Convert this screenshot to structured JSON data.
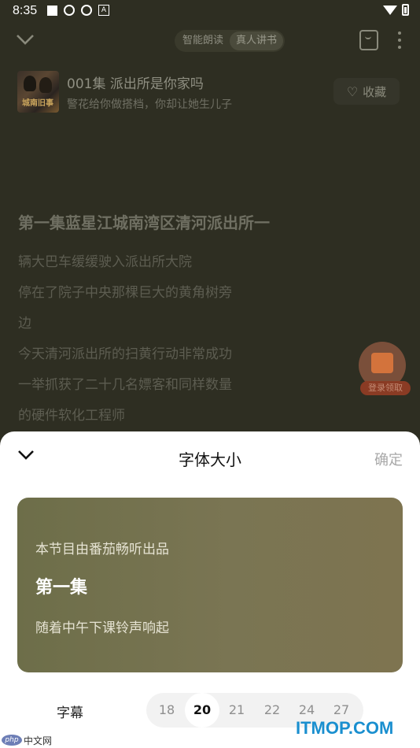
{
  "status_bar": {
    "time": "8:35",
    "icons": [
      "square-icon",
      "globe-icon",
      "globe-icon",
      "a-icon"
    ],
    "right_icons": [
      "wifi-icon",
      "battery-icon"
    ]
  },
  "top_bar": {
    "modes": [
      "智能朗读",
      "真人讲书"
    ],
    "active_mode": "真人讲书"
  },
  "episode": {
    "cover_text": "城南旧事",
    "title": "001集 派出所是你家吗",
    "subtitle": "警花给你做搭档，你却让她生儿子",
    "favorite_label": "收藏"
  },
  "reader": {
    "heading": "第一集蓝星江城南湾区清河派出所一",
    "lines": [
      "辆大巴车缓缓驶入派出所大院",
      "停在了院子中央那棵巨大的黄角树旁",
      "边",
      "今天清河派出所的扫黄行动非常成功",
      "一举抓获了二十几名嫖客和同样数量",
      "的硬件软化工程师"
    ]
  },
  "promo": {
    "label": "登录领取"
  },
  "sheet": {
    "title": "字体大小",
    "confirm": "确定",
    "preview": {
      "line1": "本节目由番茄畅听出品",
      "line2": "第一集",
      "line3": "随着中午下课铃声响起"
    },
    "subtitle_label": "字幕",
    "sizes": [
      "18",
      "20",
      "21",
      "22",
      "24",
      "27"
    ],
    "selected_size": "20"
  },
  "watermarks": {
    "left_logo": "php",
    "left_text": "中文网",
    "right_text": "ITMOP.COM"
  }
}
